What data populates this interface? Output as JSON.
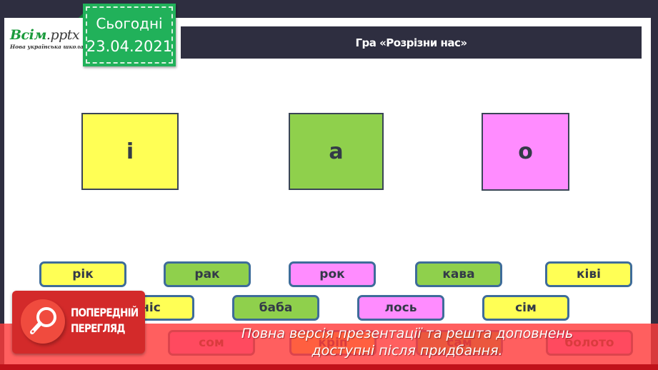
{
  "logo": {
    "brand": "Всім",
    "brand_ext": ".pptx",
    "subtitle": "Нова українська школа"
  },
  "date_badge": {
    "label": "Сьогодні",
    "date": "23.04.2021"
  },
  "title": "Гра «Розрізни нас»",
  "vowels": [
    {
      "letter": "і",
      "color": "#ffff55"
    },
    {
      "letter": "а",
      "color": "#8fd04c"
    },
    {
      "letter": "о",
      "color": "#ff8cff"
    }
  ],
  "words_row1": [
    {
      "text": "рік",
      "color": "yellow"
    },
    {
      "text": "рак",
      "color": "green"
    },
    {
      "text": "рок",
      "color": "pink"
    },
    {
      "text": "кава",
      "color": "green"
    },
    {
      "text": "ківі",
      "color": "yellow"
    }
  ],
  "words_row2": [
    {
      "text": "ніс",
      "color": "yellow"
    },
    {
      "text": "баба",
      "color": "green"
    },
    {
      "text": "лось",
      "color": "pink"
    },
    {
      "text": "сім",
      "color": "yellow"
    }
  ],
  "words_row3": [
    {
      "text": "сом",
      "color": "pink"
    },
    {
      "text": "кріп",
      "color": "yellow"
    },
    {
      "text": "сам",
      "color": "green"
    },
    {
      "text": "болото",
      "color": "pink"
    }
  ],
  "preview": {
    "line1": "ПОПЕРЕДНІЙ",
    "line2": "ПЕРЕГЛЯД",
    "notice_line1": "Повна версія презентації та решта доповнень",
    "notice_line2": "доступні після придбання."
  }
}
